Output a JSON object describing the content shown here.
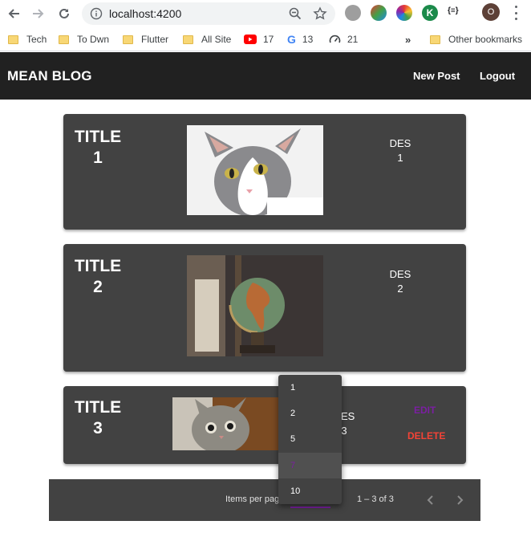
{
  "browser": {
    "url": "localhost:4200",
    "ext_label": "{≡}",
    "profile_initial": "O",
    "bookmarks": [
      {
        "label": "Tech"
      },
      {
        "label": "To Dwn"
      },
      {
        "label": "Flutter"
      },
      {
        "label": "All Site"
      },
      {
        "label": "17"
      },
      {
        "label": "13"
      },
      {
        "label": "21"
      }
    ],
    "overflow": "»",
    "other_bookmarks": "Other bookmarks"
  },
  "toolbar": {
    "title": "MEAN BLOG",
    "new_post": "New Post",
    "logout": "Logout"
  },
  "posts": [
    {
      "title": "TITLE",
      "num": "1",
      "desc": "DES",
      "desc_num": "1"
    },
    {
      "title": "TITLE",
      "num": "2",
      "desc": "DES",
      "desc_num": "2"
    },
    {
      "title": "TITLE",
      "num": "3",
      "desc": "DES",
      "desc_num": "3",
      "edit": "EDIT",
      "delete": "DELETE"
    }
  ],
  "paginator": {
    "items_label": "Items per page:",
    "range": "1 – 3 of 3",
    "options": [
      "1",
      "2",
      "5",
      "7",
      "10"
    ],
    "selected": "7"
  },
  "colors": {
    "toolbar": "#212121",
    "card": "#424242",
    "accent": "#7b1fa2",
    "warn": "#f44336"
  }
}
